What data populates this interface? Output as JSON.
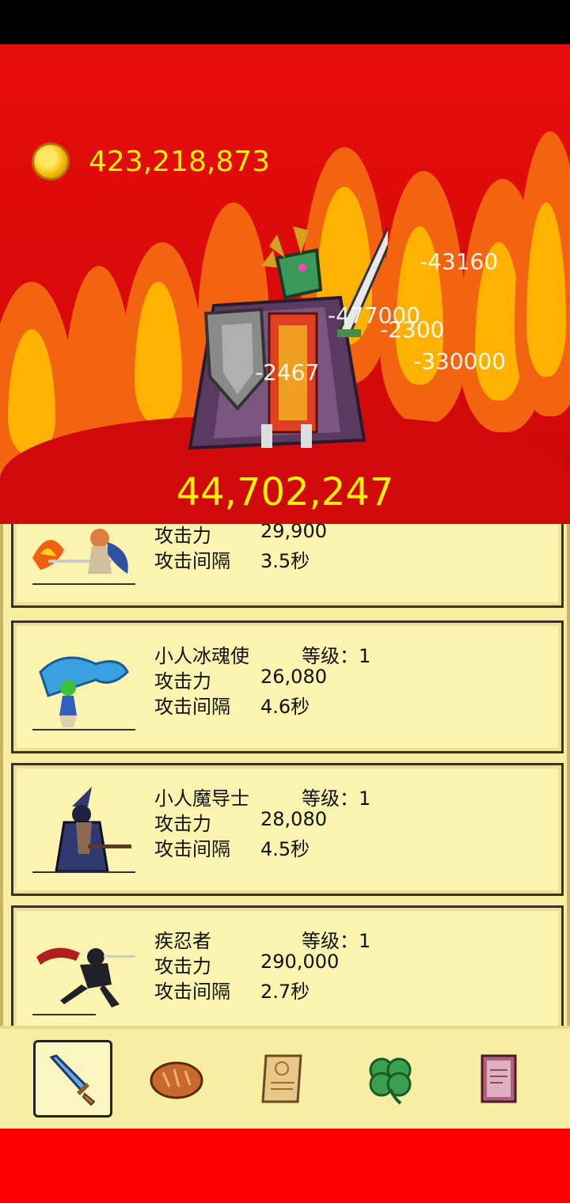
{
  "currency": {
    "amount": "423,218,873",
    "icon": "gold-coin-icon"
  },
  "boss": {
    "hp": "44,702,247",
    "name_icon": "dragon-knight-boss"
  },
  "damage_numbers": [
    "-43160",
    "-477000",
    "-2300",
    "-330000",
    "-2467"
  ],
  "heroes": [
    {
      "name": "",
      "level": "",
      "attack_label": "攻击力",
      "attack": "29,900",
      "interval_label": "攻击间隔",
      "interval": "3.5秒",
      "icon": "fire-swordswoman"
    },
    {
      "name": "小人冰魂使",
      "level": "等级：1",
      "attack_label": "攻击力",
      "attack": "26,080",
      "interval_label": "攻击间隔",
      "interval": "4.6秒",
      "icon": "ice-spirit-summoner"
    },
    {
      "name": "小人魔导士",
      "level": "等级：1",
      "attack_label": "攻击力",
      "attack": "28,080",
      "interval_label": "攻击间隔",
      "interval": "4.5秒",
      "icon": "dark-mage"
    },
    {
      "name": "疾忍者",
      "level": "等级：1",
      "attack_label": "攻击力",
      "attack": "290,000",
      "interval_label": "攻击间隔",
      "interval": "2.7秒",
      "icon": "swift-ninja"
    }
  ],
  "nav": [
    {
      "icon": "sword-icon",
      "active": true
    },
    {
      "icon": "bread-icon",
      "active": false
    },
    {
      "icon": "scroll-icon",
      "active": false
    },
    {
      "icon": "clover-icon",
      "active": false
    },
    {
      "icon": "book-icon",
      "active": false
    }
  ],
  "colors": {
    "gold_text": "#fff200",
    "bg_red": "#e60d0d",
    "panel": "#f7eea3"
  }
}
